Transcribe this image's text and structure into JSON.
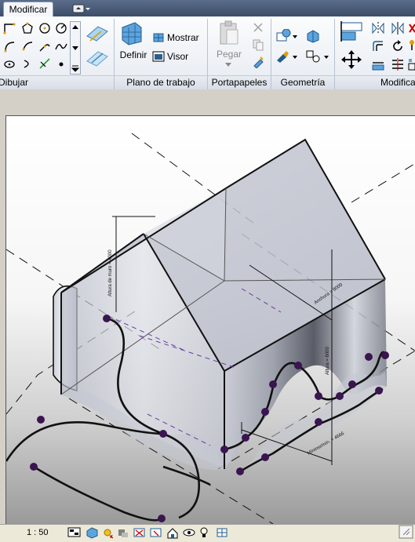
{
  "ribbon": {
    "active_tab": "Modificar",
    "panels": {
      "draw": "Dibujar",
      "workplane": "Plano de trabajo",
      "clipboard": "Portapapeles",
      "geometry": "Geometría",
      "modify": "Modificar"
    },
    "workplane": {
      "set_label": "Definir",
      "show_label": "Mostrar",
      "viewer_label": "Visor"
    },
    "clipboard": {
      "paste_label": "Pegar"
    }
  },
  "view": {
    "annotations": {
      "wall_height": "Altura de muro = 4000",
      "width": "Anchura = 8000",
      "height": "Altura = 6000",
      "min_length": "Mínimo/mín. = 4666"
    }
  },
  "statusbar": {
    "scale": "1 : 50"
  },
  "colors": {
    "tab_strip": "#3c4d69",
    "ribbon_bg": "#eef1f6",
    "point_marker": "#3a1550",
    "reference_line_purple": "#6a3aa0"
  }
}
